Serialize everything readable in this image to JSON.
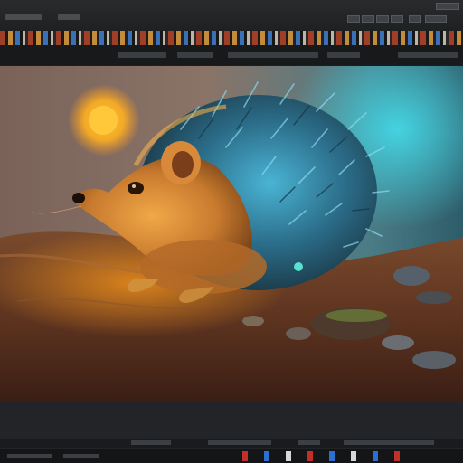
{
  "app": {
    "accent": "#3f7fd0"
  },
  "viewport": {
    "scene": "hedgehog-painting",
    "colors": {
      "sun": "#ffbf2a",
      "glow_left": "#f0a020",
      "glow_right": "#35c8d8",
      "ground": "#6a3a22",
      "quills": "#3aa0c8"
    }
  },
  "status_swatches": [
    "#c03028",
    "#2d6fd0",
    "#d8d8d8",
    "#c03028",
    "#2d6fd0",
    "#d8d8d8",
    "#2d6fd0",
    "#c03028"
  ]
}
